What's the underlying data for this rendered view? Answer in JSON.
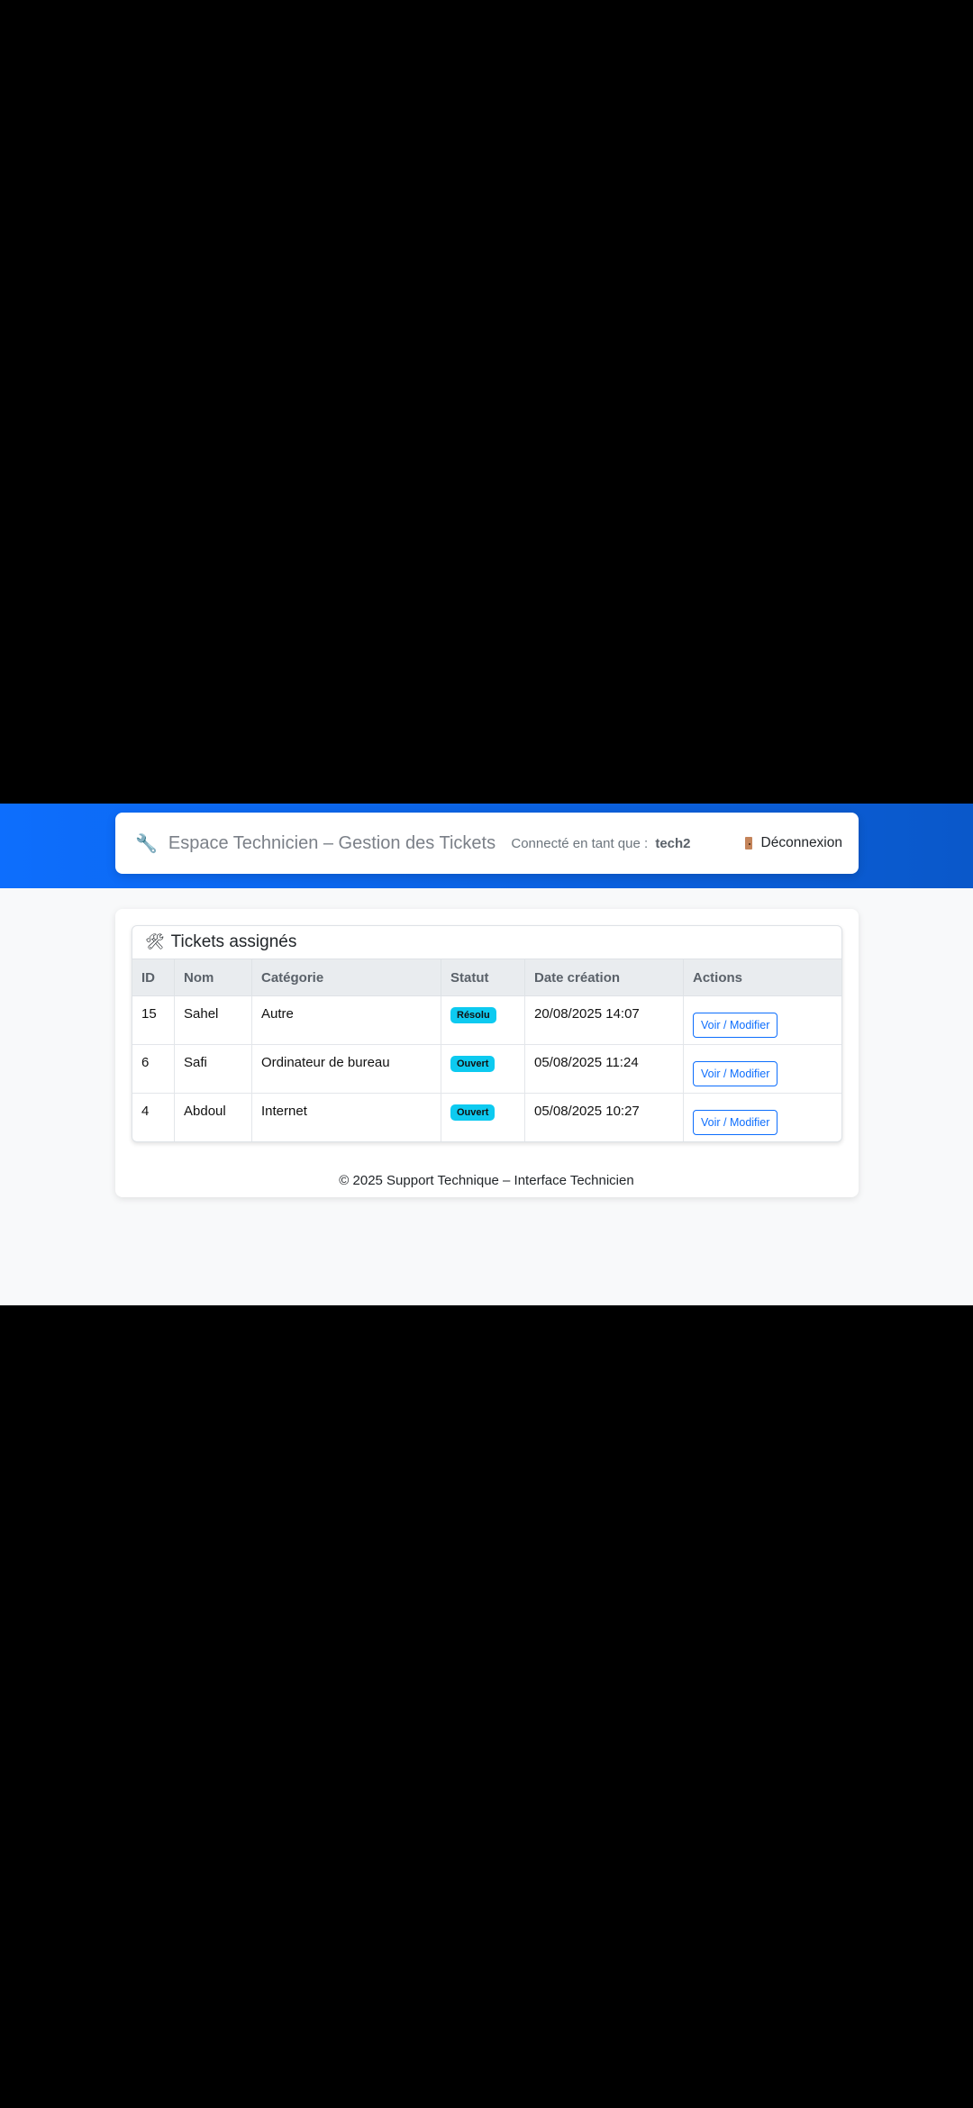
{
  "header": {
    "title": "Espace Technicien – Gestion des Tickets",
    "connected_label": "Connecté en tant que :",
    "username": "tech2",
    "logout_label": "Déconnexion"
  },
  "tickets": {
    "heading": "Tickets assignés",
    "columns": [
      "ID",
      "Nom",
      "Catégorie",
      "Statut",
      "Date création",
      "Actions"
    ],
    "rows": [
      {
        "id": "15",
        "nom": "Sahel",
        "categorie": "Autre",
        "statut": "Résolu",
        "date": "20/08/2025 14:07",
        "action": "Voir / Modifier"
      },
      {
        "id": "6",
        "nom": "Safi",
        "categorie": "Ordinateur de bureau",
        "statut": "Ouvert",
        "date": "05/08/2025 11:24",
        "action": "Voir / Modifier"
      },
      {
        "id": "4",
        "nom": "Abdoul",
        "categorie": "Internet",
        "statut": "Ouvert",
        "date": "05/08/2025 10:27",
        "action": "Voir / Modifier"
      }
    ]
  },
  "footer": {
    "text": "© 2025 Support Technique – Interface Technicien"
  },
  "colors": {
    "primary": "#0d6efd",
    "badge_info": "#0dcaf0",
    "page_bg": "#f8f9fa"
  },
  "icons": {
    "brand": "wrench-icon",
    "logout": "door-icon",
    "tickets": "hammer-wrench-icon"
  }
}
